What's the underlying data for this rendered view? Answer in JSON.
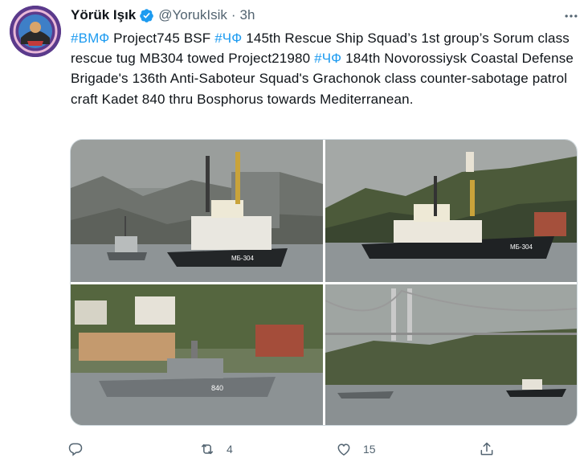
{
  "tweet": {
    "display_name": "Yörük Işık",
    "handle": "@YorukIsik",
    "separator": "·",
    "timestamp": "3h",
    "text_segments": [
      {
        "text": "#ВМФ",
        "hashtag": true
      },
      {
        "text": " Project745 BSF ",
        "hashtag": false
      },
      {
        "text": "#ЧФ",
        "hashtag": true
      },
      {
        "text": " 145th Rescue Ship Squad’s 1st group’s Sorum class rescue tug MB304 towed Project21980 ",
        "hashtag": false
      },
      {
        "text": "#ЧФ",
        "hashtag": true
      },
      {
        "text": " 184th Novorossiysk Coastal Defense Brigade's 136th Anti-Saboteur Squad's Grachonok class counter-sabotage patrol craft Kadet 840 thru Bosphorus towards Mediterranean.",
        "hashtag": false
      }
    ]
  },
  "media": {
    "photo_1_hull_label": "МБ-304",
    "photo_2_hull_label": "МБ-304",
    "photo_3_hull_label": "840"
  },
  "actions": {
    "reply_count": "",
    "retweet_count": "4",
    "like_count": "15"
  },
  "colors": {
    "hashtag": "#1d9bf0",
    "secondary_text": "#536471",
    "verified": "#1d9bf0"
  }
}
